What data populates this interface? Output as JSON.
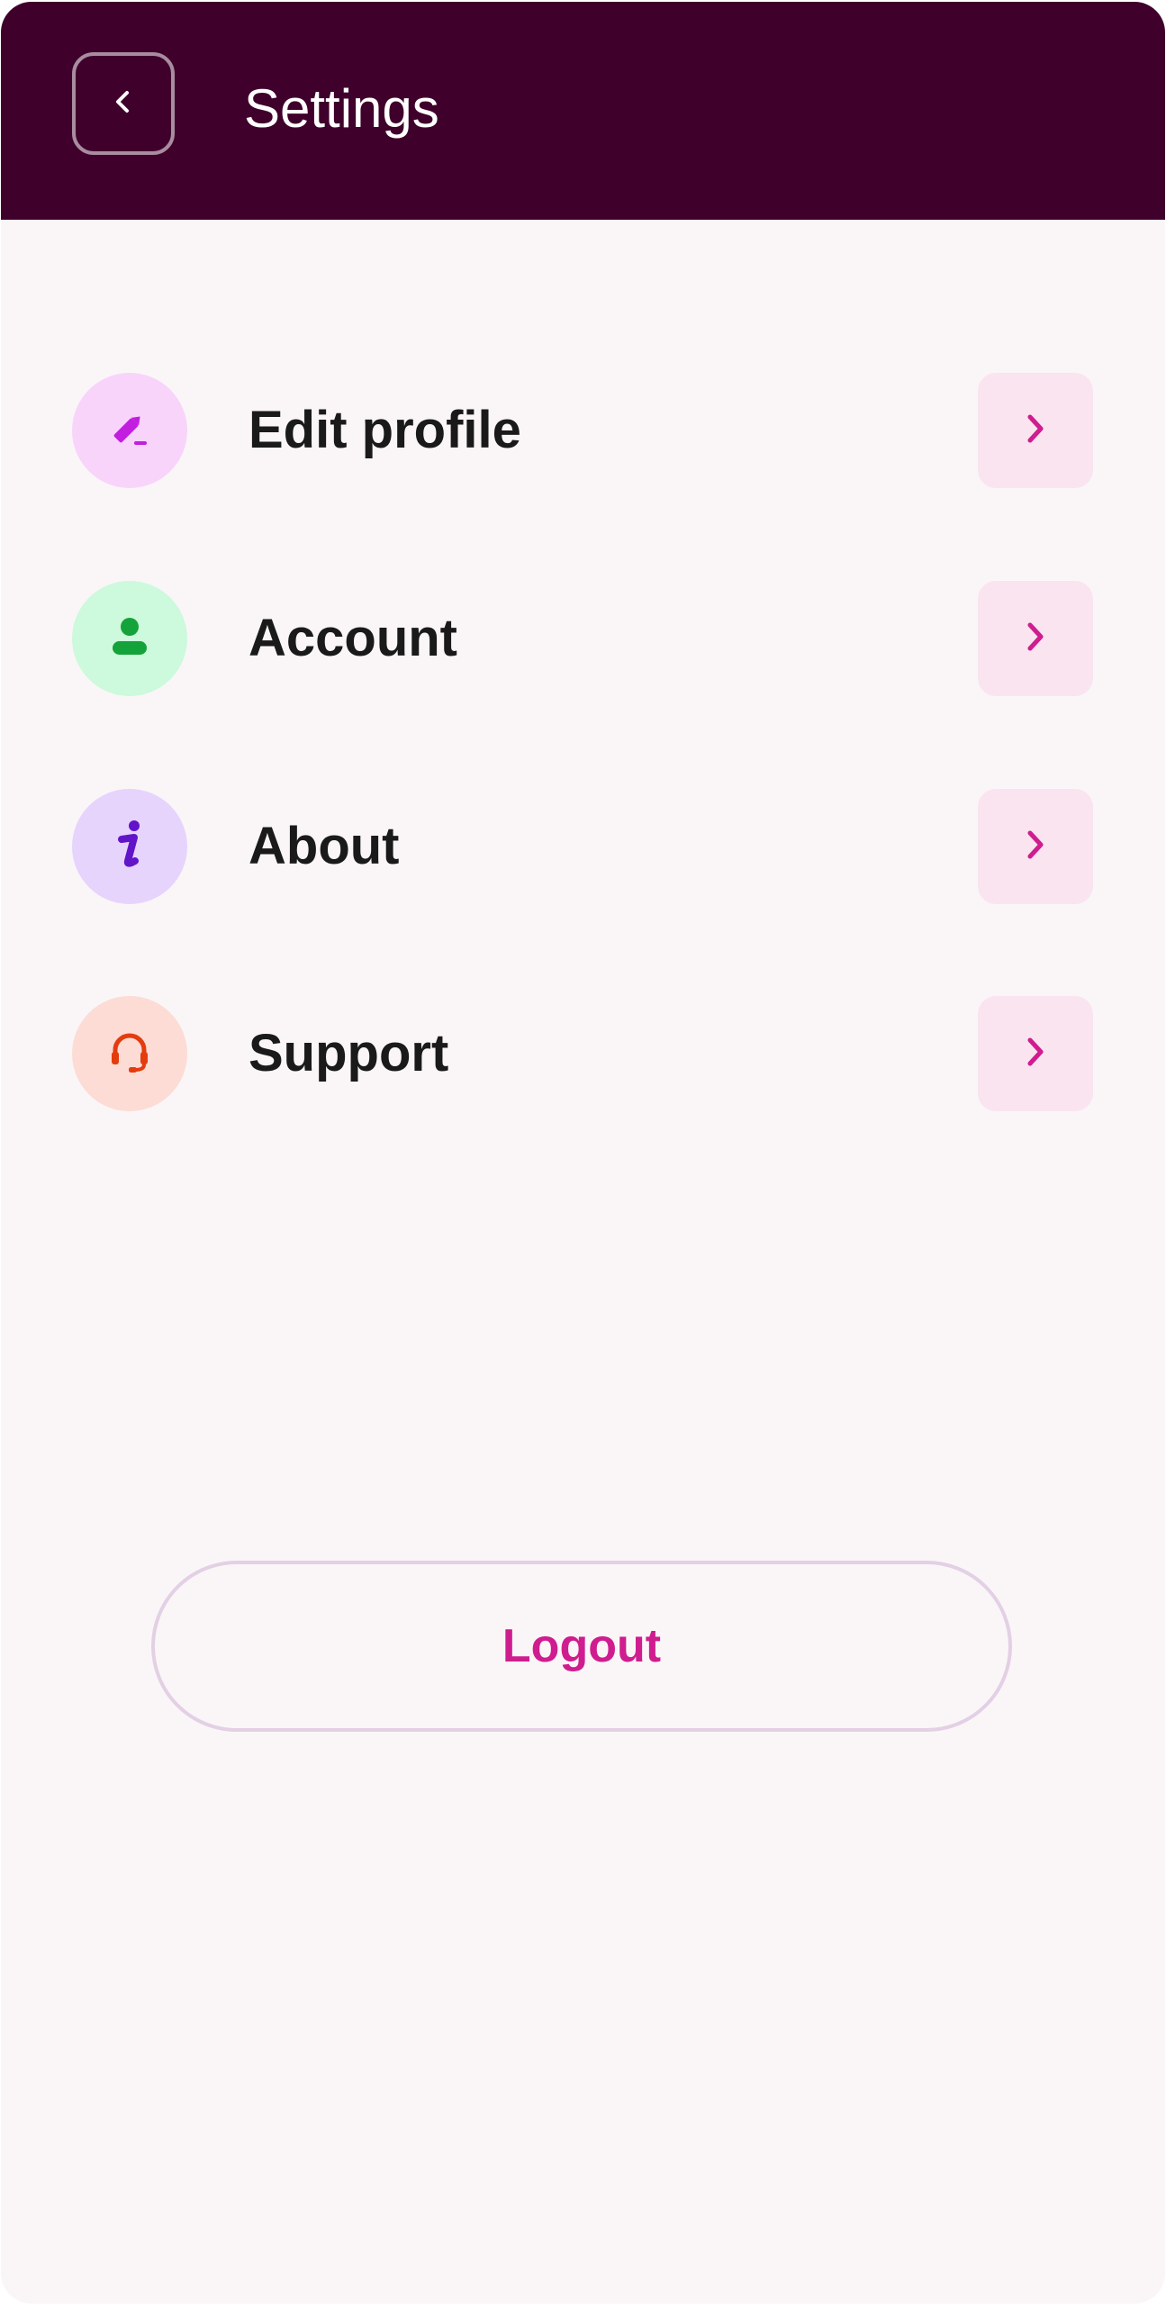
{
  "header": {
    "title": "Settings",
    "back_icon": "chevron-left-icon"
  },
  "menu": {
    "items": [
      {
        "label": "Edit profile",
        "icon": "edit-pencil-icon",
        "icon_bg": "#f8d4fb",
        "icon_color": "#c31de0"
      },
      {
        "label": "Account",
        "icon": "user-icon",
        "icon_bg": "#cdf9dc",
        "icon_color": "#14a33a"
      },
      {
        "label": "About",
        "icon": "info-icon",
        "icon_bg": "#e6d4fd",
        "icon_color": "#6214c9"
      },
      {
        "label": "Support",
        "icon": "headset-icon",
        "icon_bg": "#fcdcd5",
        "icon_color": "#e33c0f"
      }
    ],
    "chevron_icon": "chevron-right-icon"
  },
  "logout": {
    "label": "Logout"
  },
  "colors": {
    "header_bg": "#3f002b",
    "page_bg": "#faf6f8",
    "accent": "#cf1d8f",
    "chevron_bg": "#f9e4f0",
    "logout_border": "#e3d0e4"
  }
}
